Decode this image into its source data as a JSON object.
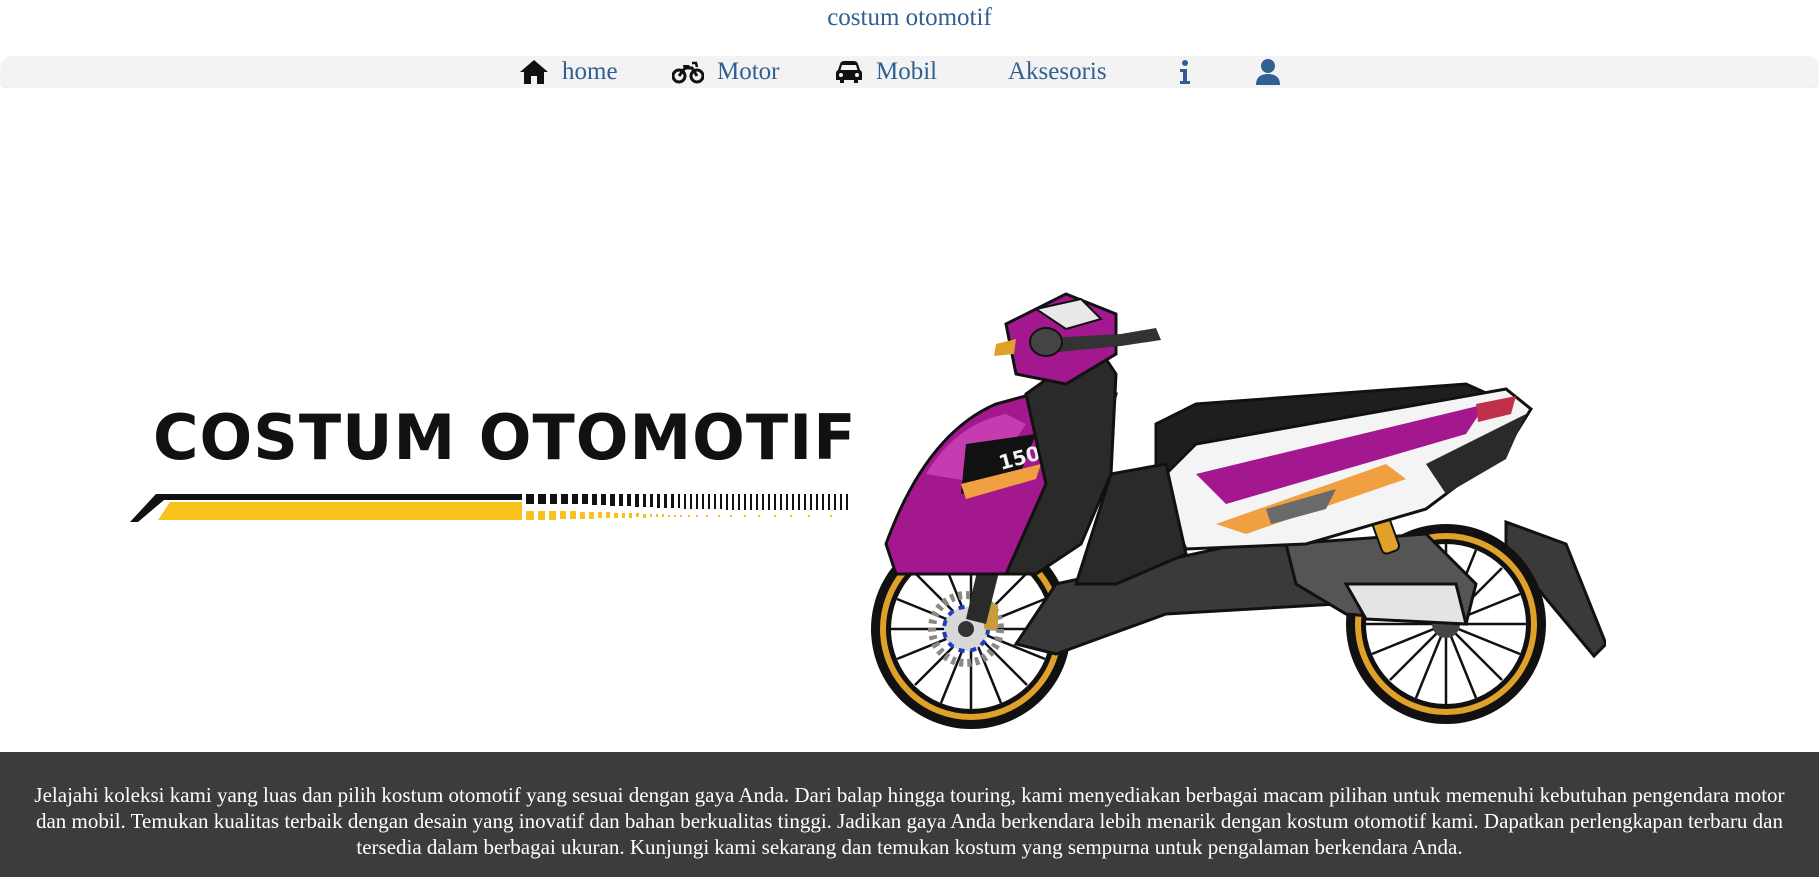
{
  "header": {
    "site_title": "costum otomotif"
  },
  "nav": {
    "items": [
      {
        "label": "home",
        "icon": "home-icon"
      },
      {
        "label": "Motor",
        "icon": "motorcycle-icon"
      },
      {
        "label": "Mobil",
        "icon": "car-icon"
      },
      {
        "label": "Aksesoris",
        "icon": ""
      },
      {
        "label": "",
        "icon": "info-icon"
      },
      {
        "label": "",
        "icon": "user-icon"
      }
    ]
  },
  "hero": {
    "logo_text": "COSTUM OTOMOTIF",
    "illustration": "scooter-illustration"
  },
  "footer": {
    "description": "Jelajahi koleksi kami yang luas dan pilih kostum otomotif yang sesuai dengan gaya Anda. Dari balap hingga touring, kami menyediakan berbagai macam pilihan untuk memenuhi kebutuhan pengendara motor dan mobil. Temukan kualitas terbaik dengan desain yang inovatif dan bahan berkualitas tinggi. Jadikan gaya Anda berkendara lebih menarik dengan kostum otomotif kami. Dapatkan perlengkapan terbaru dan tersedia dalam berbagai ukuran. Kunjungi kami sekarang dan temukan kostum yang sempurna untuk pengalaman berkendara Anda."
  },
  "colors": {
    "link": "#2f5f93",
    "navbar_bg": "#f3f3f3",
    "footer_bg": "#3c3c3c",
    "accent_yellow": "#f7c21c",
    "moto_magenta": "#a3188f"
  }
}
